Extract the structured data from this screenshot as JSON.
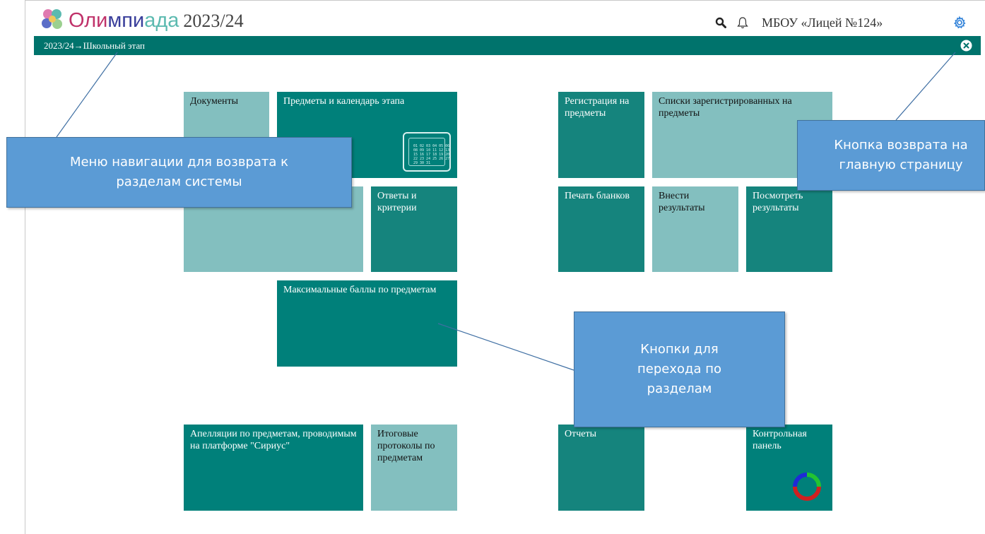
{
  "header": {
    "logo": "flower-logo",
    "title_part1": "Оли",
    "title_part2": "мпи",
    "title_part3": "ада",
    "year": "2023/24",
    "icons": [
      "search-icon",
      "bell-icon",
      "gear-icon"
    ],
    "org_name": "МБОУ «Лицей №124»"
  },
  "nav": {
    "breadcrumb": "2023/24→Школьный этап",
    "close_icon": "close-circle-icon"
  },
  "tiles": {
    "documents": "Документы",
    "subjects_calendar": "Предметы и календарь этапа",
    "calendar_text": "01 02 03 04 05 06\n08 09 10 11 12 13\n15 16 17 18 19 20\n22 23 24 25 26 27\n29 30 31",
    "answers_criteria": "Ответы и критерии",
    "max_scores": "Максимальные баллы по предметам",
    "appeals": "Апелляции по предметам, проводимым на платформе \"Сириус\"",
    "final_protocols": "Итоговые протоколы по предметам",
    "registration": "Регистрация на предметы",
    "registered_lists": "Списки зарегистрированных на предметы",
    "print_forms": "Печать бланков",
    "enter_results": "Внести результаты",
    "view_results": "Посмотреть результаты",
    "reports": "Отчеты",
    "control_panel": "Контрольная панель"
  },
  "callouts": {
    "nav_menu": "Меню навигации для возврата к разделам системы",
    "home_button": "Кнопка возврата на главную страницу",
    "section_buttons": "Кнопки для перехода по разделам"
  },
  "colors": {
    "nav_bar": "#00736c",
    "tile_dark": "#00807a",
    "tile_light": "#83bfbf",
    "callout": "#5b9bd5"
  }
}
